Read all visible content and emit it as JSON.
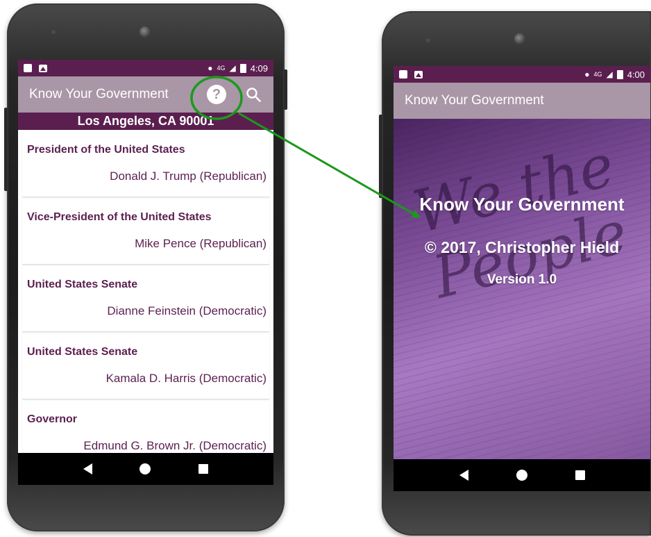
{
  "left_phone": {
    "status": {
      "time": "4:09",
      "network": "4G"
    },
    "appbar": {
      "title": "Know Your Government",
      "help_icon": "?",
      "search_icon": "search-icon"
    },
    "location": "Los Angeles, CA 90001",
    "officials": [
      {
        "office": "President of the United States",
        "official": "Donald J. Trump (Republican)"
      },
      {
        "office": "Vice-President of the United States",
        "official": "Mike Pence (Republican)"
      },
      {
        "office": "United States Senate",
        "official": "Dianne Feinstein (Democratic)"
      },
      {
        "office": "United States Senate",
        "official": "Kamala D. Harris (Democratic)"
      },
      {
        "office": "Governor",
        "official": "Edmund G. Brown Jr. (Democratic)"
      }
    ]
  },
  "right_phone": {
    "status": {
      "time": "4:00",
      "network": "4G"
    },
    "appbar": {
      "title": "Know Your Government"
    },
    "splash": {
      "title": "Know Your Government",
      "copyright": "© 2017, Christopher Hield",
      "version": "Version 1.0"
    }
  },
  "colors": {
    "primary_dark": "#5b1f4f",
    "appbar": "#a996a7",
    "annotation": "#1a9a1a"
  }
}
